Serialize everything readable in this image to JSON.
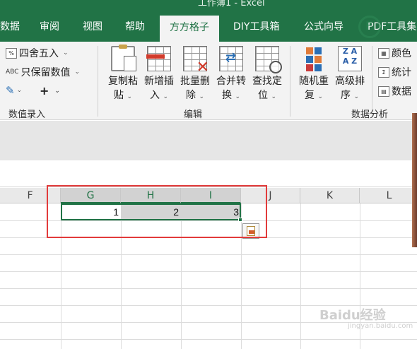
{
  "window": {
    "title": "工作簿1 - Excel"
  },
  "tabs": [
    {
      "label": "数据"
    },
    {
      "label": "审阅"
    },
    {
      "label": "视图"
    },
    {
      "label": "帮助"
    },
    {
      "label": "方方格子"
    },
    {
      "label": "DIY工具箱"
    },
    {
      "label": "公式向导"
    },
    {
      "label": "PDF工具集"
    }
  ],
  "active_tab": "方方格子",
  "ribbon": {
    "value_entry": {
      "round_label": "四舍五入",
      "keep_value_label": "只保留数值",
      "plus_label": "+",
      "group_label": "数值录入"
    },
    "edit": {
      "group_label": "编辑",
      "buttons": [
        {
          "line1": "复制粘",
          "line2": "贴"
        },
        {
          "line1": "新增插",
          "line2": "入"
        },
        {
          "line1": "批量删",
          "line2": "除"
        },
        {
          "line1": "合并转",
          "line2": "换"
        },
        {
          "line1": "查找定",
          "line2": "位"
        }
      ]
    },
    "analysis": {
      "group_label": "数据分析",
      "buttons": [
        {
          "line1": "随机重",
          "line2": "复"
        },
        {
          "line1": "高级排",
          "line2": "序"
        }
      ],
      "small_items": [
        "颜色",
        "统计",
        "数据"
      ]
    }
  },
  "sheet": {
    "columns": [
      "F",
      "G",
      "H",
      "I",
      "J",
      "K",
      "L"
    ],
    "selected_columns": [
      "G",
      "H",
      "I"
    ],
    "row_values": {
      "G": "1",
      "H": "2",
      "I": "3"
    }
  },
  "colors": {
    "excel_green": "#217346",
    "highlight_red": "#e23b3b",
    "selection_gray": "#d4d4d4"
  },
  "watermark": {
    "brand": "Baidu经验",
    "sub": "jingyan.baidu.com"
  }
}
